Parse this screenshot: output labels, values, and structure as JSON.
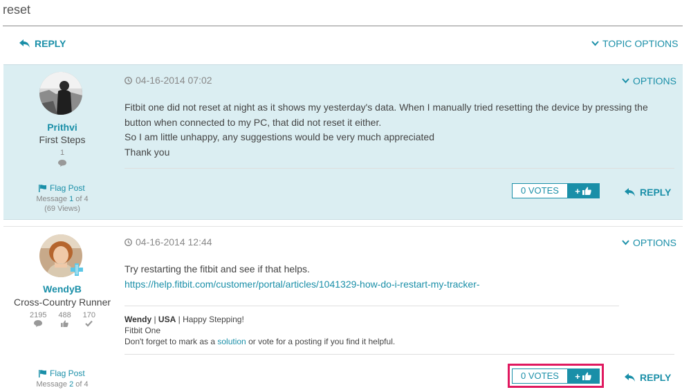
{
  "title": "reset",
  "top_bar": {
    "reply_label": "REPLY",
    "topic_options_label": "TOPIC OPTIONS"
  },
  "colors": {
    "accent": "#1a8fa8",
    "post_highlight_bg": "#dbeef2",
    "annotation_box": "#e0185f"
  },
  "posts": [
    {
      "username": "Prithvi",
      "rank": "First Steps",
      "post_count": "1",
      "flag_label": "Flag Post",
      "message_prefix": "Message",
      "message_index": "1",
      "message_suffix": "of 4",
      "views": "(69 Views)",
      "datetime": "04-16-2014 07:02",
      "options_label": "OPTIONS",
      "body_lines": [
        "Fitbit one did not reset at night as it shows my yesterday's data. When I manually tried resetting the device by pressing the",
        "button when connected to my PC, that did not reset it either.",
        "So I am little unhappy, any suggestions would be very much appreciated",
        "Thank you"
      ],
      "votes_label": "0 VOTES",
      "plus_label": "+",
      "reply_label": "REPLY"
    },
    {
      "username": "WendyB",
      "rank": "Cross-Country Runner",
      "stats": [
        "2195",
        "488",
        "170"
      ],
      "flag_label": "Flag Post",
      "message_prefix": "Message",
      "message_index": "2",
      "message_suffix": "of 4",
      "datetime": "04-16-2014 12:44",
      "options_label": "OPTIONS",
      "body_line1": "Try restarting the fitbit and see if that helps.",
      "body_link": "https://help.fitbit.com/customer/portal/articles/1041329-how-do-i-restart-my-tracker-",
      "signature": {
        "name": "Wendy",
        "sep1": " | ",
        "country": "USA",
        "sep2": " | ",
        "tagline": "Happy Stepping!",
        "device": "Fitbit One",
        "note_prefix": "Don't forget to mark as a ",
        "note_link": "solution",
        "note_suffix": " or vote for a posting if you find it helpful."
      },
      "votes_label": "0 VOTES",
      "plus_label": "+",
      "reply_label": "REPLY"
    }
  ]
}
